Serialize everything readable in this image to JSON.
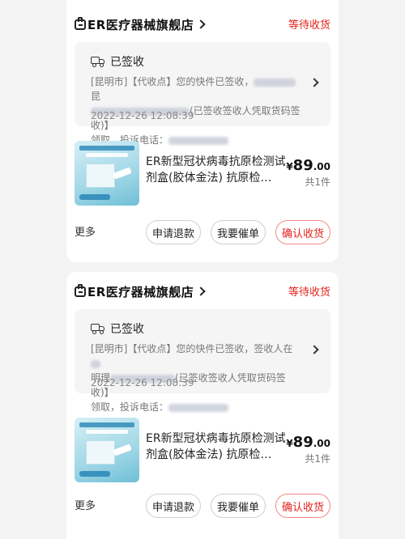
{
  "orders": [
    {
      "shop_name": "ER医疗器械旗舰店",
      "status": "等待收货",
      "logistics": {
        "title": "已签收",
        "text_a": "[昆明市]【代收点】您的快件已签收，",
        "text_b": "昆",
        "text_c": "(已签收签收人凭取货码签收)】",
        "text_d": "领取，投诉电话：",
        "time": "2022-12-26 12:08:39"
      },
      "product": {
        "name": "ER新型冠状病毒抗原检测试剂盒(胶体金法) 抗原检…",
        "price_currency": "¥",
        "price_int": "89",
        "price_dec": ".00",
        "quantity": "共1件"
      },
      "actions": {
        "more": "更多",
        "refund": "申请退款",
        "urge": "我要催单",
        "confirm": "确认收货"
      }
    },
    {
      "shop_name": "ER医疗器械旗舰店",
      "status": "等待收货",
      "logistics": {
        "title": "已签收",
        "text_a": "[昆明市]【代收点】您的快件已签收，签收人在",
        "text_b": "明理",
        "text_c": "(已签收签收人凭取货码签收)】",
        "text_d": "领取，投诉电话：",
        "time": "2022-12-26 12:08:39"
      },
      "product": {
        "name": "ER新型冠状病毒抗原检测试剂盒(胶体金法) 抗原检…",
        "price_currency": "¥",
        "price_int": "89",
        "price_dec": ".00",
        "quantity": "共1件"
      },
      "actions": {
        "more": "更多",
        "refund": "申请退款",
        "urge": "我要催单",
        "confirm": "确认收货"
      }
    }
  ],
  "colors": {
    "accent": "#e2231a",
    "background": "#f3f3f3",
    "card": "#ffffff",
    "logistics_bg": "#f5f5f5"
  },
  "icons": {
    "shop": "shop-icon",
    "truck": "truck-icon",
    "chevron": "chevron-right-icon"
  }
}
